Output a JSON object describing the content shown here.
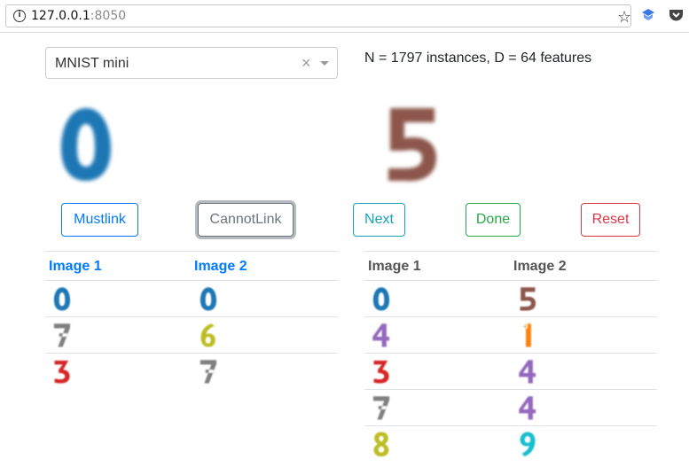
{
  "browser": {
    "url_host": "127.0.0.1",
    "url_port": ":8050",
    "icons": [
      "info-icon",
      "star-icon",
      "extension-icon",
      "pocket-icon"
    ]
  },
  "dataset_select": {
    "value": "MNIST mini",
    "clear_glyph": "×"
  },
  "dataset_info": "N = 1797 instances, D = 64 features",
  "preview": {
    "left_digit": "0",
    "left_color": "#1f77b4",
    "right_digit": "5",
    "right_color": "#8c564b"
  },
  "buttons": {
    "mustlink": "Mustlink",
    "cannotlink": "CannotLink",
    "next": "Next",
    "done": "Done",
    "reset": "Reset"
  },
  "mustlink_table": {
    "headers": [
      "Image 1",
      "Image 2"
    ],
    "rows": [
      [
        {
          "digit": "0",
          "color": "#1f77b4"
        },
        {
          "digit": "0",
          "color": "#1f77b4"
        }
      ],
      [
        {
          "digit": "7",
          "color": "#7f7f7f"
        },
        {
          "digit": "6",
          "color": "#bcbd22"
        }
      ],
      [
        {
          "digit": "3",
          "color": "#d62728"
        },
        {
          "digit": "7",
          "color": "#7f7f7f"
        }
      ]
    ]
  },
  "cannotlink_table": {
    "headers": [
      "Image 1",
      "Image 2"
    ],
    "rows": [
      [
        {
          "digit": "0",
          "color": "#1f77b4"
        },
        {
          "digit": "5",
          "color": "#8c564b"
        }
      ],
      [
        {
          "digit": "4",
          "color": "#9467bd"
        },
        {
          "digit": "1",
          "color": "#ff7f0e"
        }
      ],
      [
        {
          "digit": "3",
          "color": "#d62728"
        },
        {
          "digit": "4",
          "color": "#9467bd"
        }
      ],
      [
        {
          "digit": "7",
          "color": "#7f7f7f"
        },
        {
          "digit": "4",
          "color": "#9467bd"
        }
      ],
      [
        {
          "digit": "8",
          "color": "#bcbd22"
        },
        {
          "digit": "9",
          "color": "#17becf"
        }
      ]
    ]
  }
}
